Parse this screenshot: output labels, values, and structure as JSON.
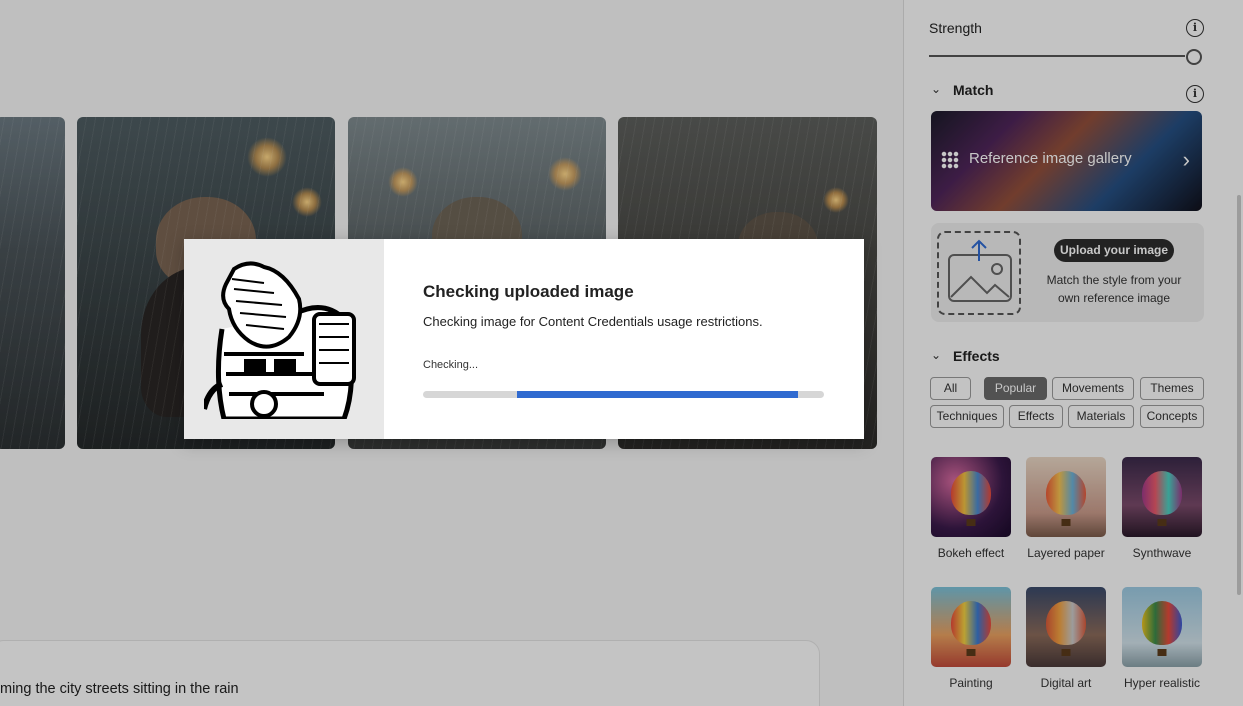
{
  "main": {
    "prompt_text": "ming the city streets sitting in the rain"
  },
  "panel": {
    "strength": {
      "label": "Strength",
      "value": 1.0
    },
    "match": {
      "title": "Match",
      "gallery_label": "Reference image gallery",
      "upload_button": "Upload your image",
      "upload_description": "Match the style from your own reference image"
    },
    "effects": {
      "title": "Effects",
      "chips": [
        {
          "label": "All",
          "active": false
        },
        {
          "label": "Popular",
          "active": true
        },
        {
          "label": "Movements",
          "active": false
        },
        {
          "label": "Themes",
          "active": false
        },
        {
          "label": "Techniques",
          "active": false
        },
        {
          "label": "Effects",
          "active": false
        },
        {
          "label": "Materials",
          "active": false
        },
        {
          "label": "Concepts",
          "active": false
        }
      ],
      "items": [
        {
          "label": "Bokeh effect"
        },
        {
          "label": "Layered paper"
        },
        {
          "label": "Synthwave"
        },
        {
          "label": "Painting"
        },
        {
          "label": "Digital art"
        },
        {
          "label": "Hyper realistic"
        }
      ]
    }
  },
  "dialog": {
    "title": "Checking uploaded image",
    "description": "Checking image for Content Credentials usage restrictions.",
    "status": "Checking...",
    "progress": {
      "start": 0.235,
      "end": 0.935
    }
  },
  "colors": {
    "accent": "#2f6ad0",
    "active_chip": "#6a6a6a"
  }
}
